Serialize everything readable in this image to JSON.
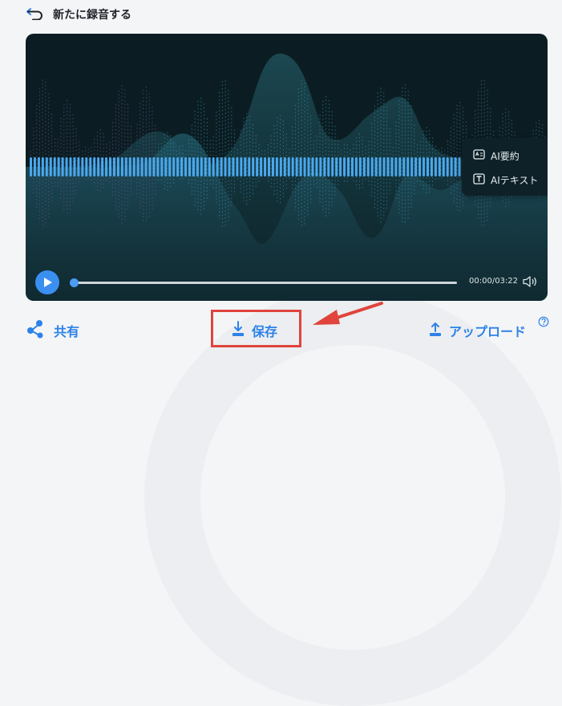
{
  "header": {
    "title": "新たに録音する"
  },
  "player": {
    "side_menu": [
      {
        "label": "AI要約",
        "icon": "ai-summary-icon"
      },
      {
        "label": "AIテキスト",
        "icon": "text-icon"
      }
    ],
    "time": "00:00/03:22",
    "progress": 0,
    "play_icon": "play-icon",
    "volume_icon": "volume-icon"
  },
  "actions": {
    "share_label": "共有",
    "save_label": "保存",
    "upload_label": "アップロード"
  },
  "colors": {
    "accent": "#2c82e8",
    "player_bg": "#0b1d22",
    "waveform": "#4aa8ee",
    "highlight": "#e0443c"
  }
}
